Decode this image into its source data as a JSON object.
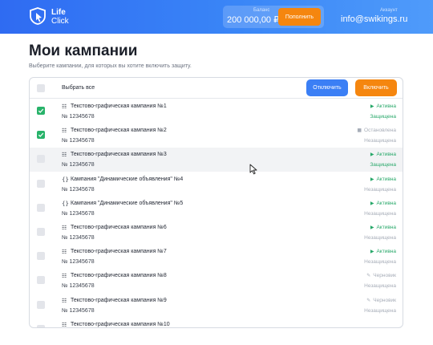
{
  "brand": {
    "line1": "Life",
    "line2": "Click"
  },
  "balance": {
    "label": "Баланс",
    "value": "200 000,00 ₽",
    "topup_label": "Пополнить"
  },
  "account": {
    "label": "Аккаунт",
    "email": "info@swikings.ru"
  },
  "page": {
    "title": "Мои кампании",
    "subtitle": "Выберите кампании, для которых вы хотите включить защиту."
  },
  "toolbar": {
    "select_all_label": "Выбрать все",
    "disable_label": "Отключить",
    "enable_label": "Включить"
  },
  "colors": {
    "accent_blue": "#3b7ff5",
    "accent_orange": "#f5860f",
    "active_green": "#28a86a",
    "muted": "#a7adb8"
  },
  "campaigns": [
    {
      "type_icon": "text-graphic-icon",
      "icon_glyph": "☷",
      "name": "Текстово-графическая кампания №1",
      "number": "№ 12345678",
      "status": "Активна",
      "status_icon": "▶",
      "status_kind": "active",
      "protection": "Защищена",
      "protection_kind": "yes",
      "checked": true
    },
    {
      "type_icon": "text-graphic-icon",
      "icon_glyph": "☷",
      "name": "Текстово-графическая кампания №2",
      "number": "№ 12345678",
      "status": "Остановлена",
      "status_icon": "■",
      "status_kind": "stop",
      "protection": "Незащищена",
      "protection_kind": "no",
      "checked": true
    },
    {
      "type_icon": "text-graphic-icon",
      "icon_glyph": "☷",
      "name": "Текстово-графическая кампания №3",
      "number": "№ 12345678",
      "status": "Активна",
      "status_icon": "▶",
      "status_kind": "active",
      "protection": "Защищена",
      "protection_kind": "yes",
      "checked": false
    },
    {
      "type_icon": "dynamic-ads-icon",
      "icon_glyph": "{}",
      "name": "Кампания \"Динамические объявления\" №4",
      "number": "№ 12345678",
      "status": "Активна",
      "status_icon": "▶",
      "status_kind": "active",
      "protection": "Незащищена",
      "protection_kind": "no",
      "checked": false
    },
    {
      "type_icon": "dynamic-ads-icon",
      "icon_glyph": "{}",
      "name": "Кампания \"Динамические объявления\" №5",
      "number": "№ 12345678",
      "status": "Активна",
      "status_icon": "▶",
      "status_kind": "active",
      "protection": "Незащищена",
      "protection_kind": "no",
      "checked": false
    },
    {
      "type_icon": "text-graphic-icon",
      "icon_glyph": "☷",
      "name": "Текстово-графическая кампания №6",
      "number": "№ 12345678",
      "status": "Активна",
      "status_icon": "▶",
      "status_kind": "active",
      "protection": "Незащищена",
      "protection_kind": "no",
      "checked": false
    },
    {
      "type_icon": "text-graphic-icon",
      "icon_glyph": "☷",
      "name": "Текстово-графическая кампания №7",
      "number": "№ 12345678",
      "status": "Активна",
      "status_icon": "▶",
      "status_kind": "active",
      "protection": "Незащищена",
      "protection_kind": "no",
      "checked": false
    },
    {
      "type_icon": "text-graphic-icon",
      "icon_glyph": "☷",
      "name": "Текстово-графическая кампания №8",
      "number": "№ 12345678",
      "status": "Черновик",
      "status_icon": "✎",
      "status_kind": "draft",
      "protection": "Незащищена",
      "protection_kind": "no",
      "checked": false
    },
    {
      "type_icon": "text-graphic-icon",
      "icon_glyph": "☷",
      "name": "Текстово-графическая кампания №9",
      "number": "№ 12345678",
      "status": "Черновик",
      "status_icon": "✎",
      "status_kind": "draft",
      "protection": "Незащищена",
      "protection_kind": "no",
      "checked": false
    },
    {
      "type_icon": "text-graphic-icon",
      "icon_glyph": "☷",
      "name": "Текстово-графическая кампания №10",
      "number": "",
      "status": "",
      "status_icon": "",
      "status_kind": "draft",
      "protection": "",
      "protection_kind": "no",
      "checked": false
    }
  ]
}
